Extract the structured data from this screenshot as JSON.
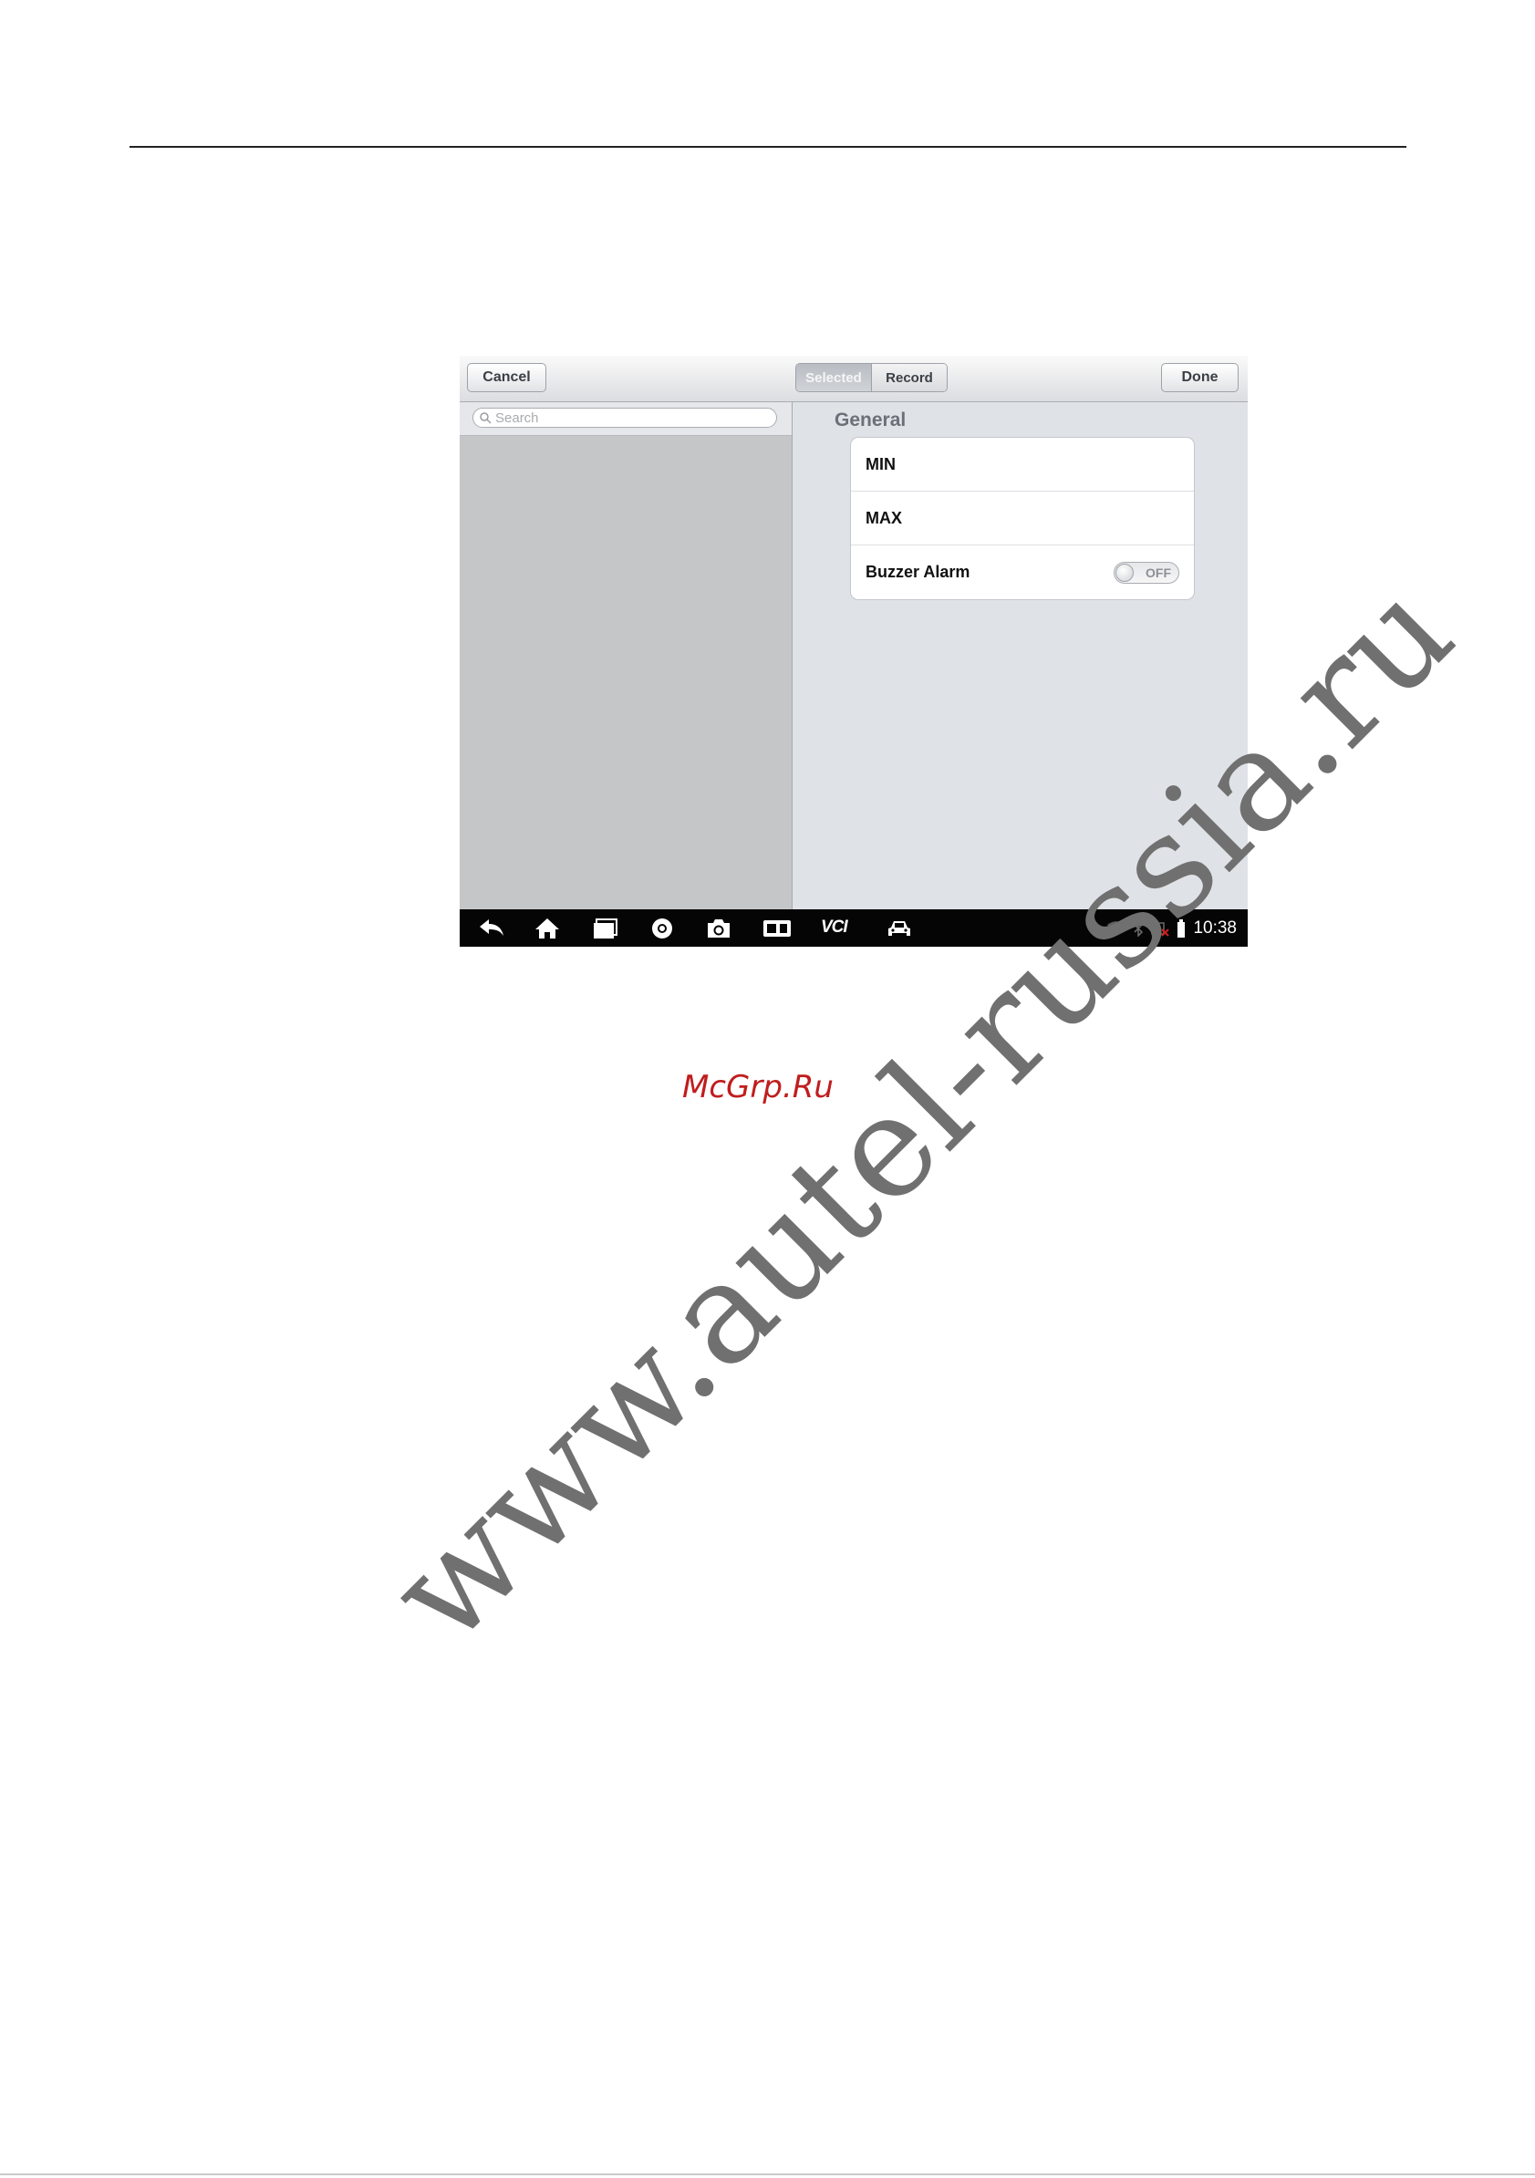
{
  "toolbar": {
    "cancel_label": "Cancel",
    "segments": [
      "Selected",
      "Record"
    ],
    "selected_segment": "Selected",
    "done_label": "Done"
  },
  "search": {
    "placeholder": "Search",
    "icon": "search-icon"
  },
  "settings": {
    "section_title": "General",
    "rows": [
      {
        "label": "MIN"
      },
      {
        "label": "MAX"
      },
      {
        "label": "Buzzer Alarm",
        "toggle": "OFF"
      }
    ]
  },
  "navbar": {
    "icons": [
      "back-icon",
      "home-icon",
      "recent-apps-icon",
      "browser-icon",
      "camera-icon",
      "display-icon",
      "vci-icon",
      "car-icon"
    ],
    "vcl_label": "VCI",
    "status_icons": [
      "wifi-icon",
      "bluetooth-icon",
      "vci-status-icon",
      "battery-icon"
    ],
    "time": "10:38"
  },
  "watermarks": {
    "small": "McGrp.Ru",
    "large": "www.autel-russia.ru"
  },
  "colors": {
    "nav_bar": "#050505",
    "left_pane": "#c5c6c8",
    "right_pane": "#dfe2e6",
    "watermark_red": "#c01d1d",
    "watermark_gray": "#707070"
  }
}
